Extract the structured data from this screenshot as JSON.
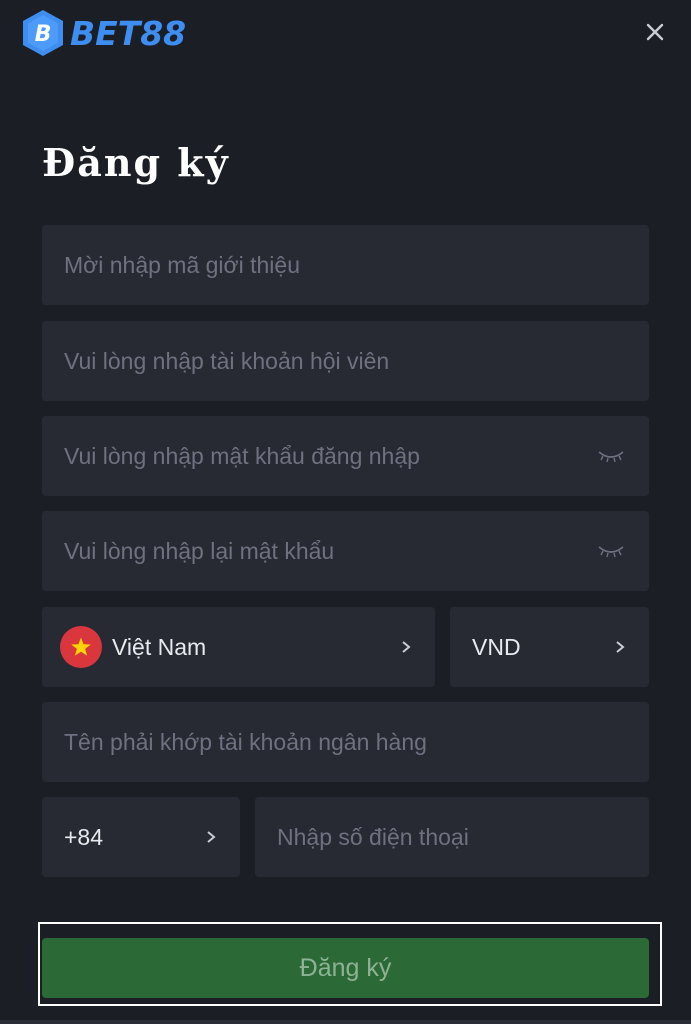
{
  "header": {
    "brand_name": "BET88",
    "logo_letter": "B",
    "close_icon": "close-icon"
  },
  "form": {
    "title": "Đăng ký",
    "referral_placeholder": "Mời nhập mã giới thiệu",
    "username_placeholder": "Vui lòng nhập tài khoản hội viên",
    "password_placeholder": "Vui lòng nhập mật khẩu đăng nhập",
    "confirm_password_placeholder": "Vui lòng nhập lại mật khẩu",
    "country": {
      "value": "Việt Nam",
      "flag_icon": "vietnam-flag-icon"
    },
    "currency": {
      "value": "VND"
    },
    "fullname_placeholder": "Tên phải khớp tài khoản ngân hàng",
    "phone_code": {
      "value": "+84"
    },
    "phone_placeholder": "Nhập số điện thoại",
    "submit_label": "Đăng ký"
  },
  "colors": {
    "background": "#1c1e26",
    "field": "#272a33",
    "brand_blue": "#3d8ef0",
    "button_green": "#2b6a37",
    "flag_red": "#d9363e",
    "flag_star": "#ffd400"
  }
}
